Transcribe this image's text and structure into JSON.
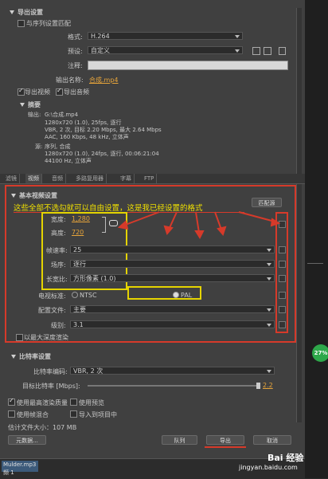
{
  "export_settings": {
    "title": "导出设置",
    "match_sequence": "与序列设置匹配",
    "format_label": "格式:",
    "format_value": "H.264",
    "preset_label": "预设:",
    "preset_value": "自定义",
    "comment_label": "注释:",
    "output_name_label": "输出名称:",
    "output_name_value": "合成.mp4",
    "export_video": "导出视频",
    "export_audio": "导出音频"
  },
  "summary": {
    "title": "摘要",
    "output_label": "输出:",
    "output_lines": [
      "G:\\合成.mp4",
      "1280x720 (1.0), 25fps, 逐行",
      "VBR, 2 次, 目标 2.20 Mbps, 最大 2.64 Mbps",
      "AAC, 160 Kbps, 48 kHz, 立体声"
    ],
    "source_label": "源:",
    "source_lines": [
      "序列, 合成",
      "1280x720 (1.0), 24fps, 逐行, 00:06:21:04",
      "44100 Hz, 立体声"
    ]
  },
  "tabs": [
    "滤镜",
    "视频",
    "音频",
    "多路复用器",
    "字幕",
    "FTP"
  ],
  "basic_video": {
    "title": "基本视频设置",
    "match_source_button": "匹配源",
    "annotation": "这些全部不选勾就可以自由设置，这是我已经设置的格式",
    "width_label": "宽度:",
    "width_value": "1,280",
    "height_label": "高度:",
    "height_value": "720",
    "framerate_label": "帧速率:",
    "framerate_value": "25",
    "field_label": "场序:",
    "field_value": "逐行",
    "aspect_label": "长宽比:",
    "aspect_value": "方形像素 (1.0)",
    "tv_standard_label": "电视标准:",
    "ntsc": "NTSC",
    "pal": "PAL",
    "profile_label": "配置文件:",
    "profile_value": "主要",
    "level_label": "级别:",
    "level_value": "3.1",
    "max_depth": "以最大深度渲染"
  },
  "bitrate": {
    "title": "比特率设置",
    "encoding_label": "比特率编码:",
    "encoding_value": "VBR, 2 次",
    "target_label": "目标比特率 [Mbps]:",
    "target_value": "2.2"
  },
  "bottom": {
    "max_render_quality": "使用最高渲染质量",
    "use_preview": "使用预览",
    "frame_blend": "使用帧混合",
    "import_project": "导入到项目中",
    "estimated_size": "估计文件大小：107 MB",
    "metadata_button": "元数据...",
    "queue_button": "队列",
    "export_button": "导出",
    "cancel_button": "取消"
  },
  "timeline": {
    "clip_label": "Mulder.mp3",
    "clip_label2": "频 1"
  },
  "side": {
    "percent": "27%"
  },
  "watermark": {
    "text": "jingyan.baidu.com",
    "brand": "Bai 经验"
  },
  "colors": {
    "annotation_red": "#d63a2a",
    "annotation_yellow": "#e5d400",
    "link_orange": "#e8a53a",
    "badge_green": "#2ea84a"
  }
}
